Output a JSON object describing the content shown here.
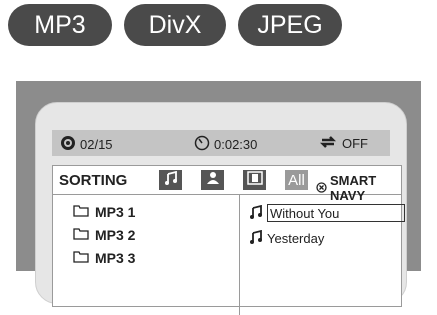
{
  "badges": [
    "MP3",
    "DivX",
    "JPEG"
  ],
  "status": {
    "track_counter": "02/15",
    "elapsed_time": "0:02:30",
    "repeat_state": "OFF"
  },
  "sorting": {
    "label": "SORTING",
    "all_label": "All",
    "smart_navy_label": "SMART NAVY"
  },
  "folders": [
    "MP3 1",
    "MP3 2",
    "MP3 3"
  ],
  "tracks": [
    "Without You",
    "Yesterday"
  ]
}
